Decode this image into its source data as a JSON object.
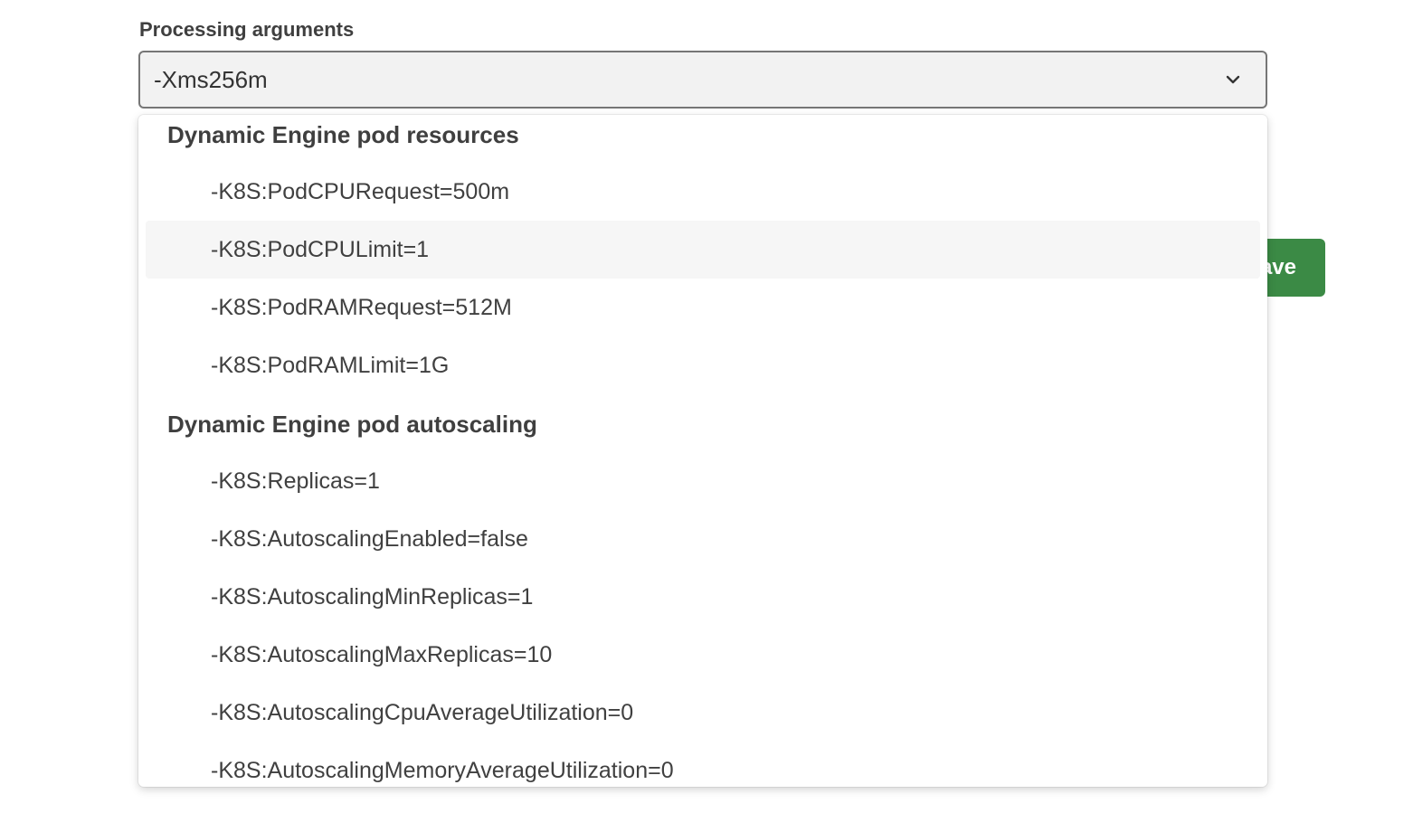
{
  "field": {
    "label": "Processing arguments",
    "selected_value": "-Xms256m",
    "chevron_icon": "chevron-down-icon"
  },
  "save_button": {
    "label": "ave"
  },
  "dropdown": {
    "groups": [
      {
        "heading": "Dynamic Engine pod resources",
        "options": [
          "-K8S:PodCPURequest=500m",
          "-K8S:PodCPULimit=1",
          "-K8S:PodRAMRequest=512M",
          "-K8S:PodRAMLimit=1G"
        ]
      },
      {
        "heading": "Dynamic Engine pod autoscaling",
        "options": [
          "-K8S:Replicas=1",
          "-K8S:AutoscalingEnabled=false",
          "-K8S:AutoscalingMinReplicas=1",
          "-K8S:AutoscalingMaxReplicas=10",
          "-K8S:AutoscalingCpuAverageUtilization=0",
          "-K8S:AutoscalingMemoryAverageUtilization=0"
        ]
      }
    ],
    "highlighted_option": "-K8S:PodCPULimit=1"
  },
  "colors": {
    "save_button_bg": "#3b8a45",
    "highlight_bg": "#f6f6f6",
    "select_border": "#767676"
  }
}
